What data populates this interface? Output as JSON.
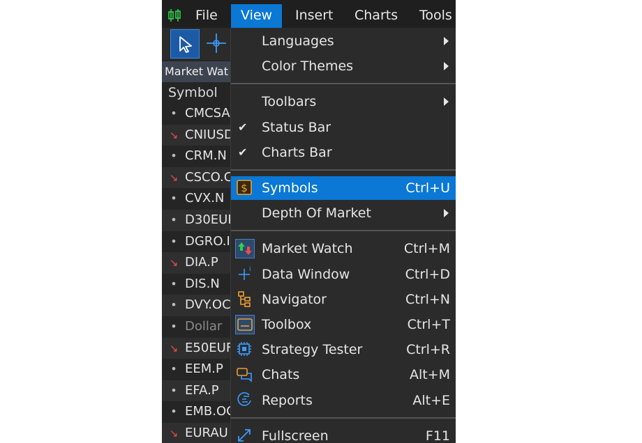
{
  "menubar": {
    "items": [
      "File",
      "View",
      "Insert",
      "Charts",
      "Tools"
    ],
    "active": "View"
  },
  "toolbar": {
    "tools": [
      "cursor-icon",
      "crosshair-icon"
    ]
  },
  "market_watch": {
    "tab_title": "Market Wat",
    "column_header": "Symbol",
    "rows": [
      {
        "symbol": "CMCSA",
        "trend": "dot",
        "dim": false
      },
      {
        "symbol": "CNIUSD",
        "trend": "down",
        "dim": false
      },
      {
        "symbol": "CRM.N",
        "trend": "dot",
        "dim": false
      },
      {
        "symbol": "CSCO.C",
        "trend": "down",
        "dim": false
      },
      {
        "symbol": "CVX.N",
        "trend": "dot",
        "dim": false
      },
      {
        "symbol": "D30EUF",
        "trend": "dot",
        "dim": false
      },
      {
        "symbol": "DGRO.I",
        "trend": "dot",
        "dim": false
      },
      {
        "symbol": "DIA.P",
        "trend": "down",
        "dim": false
      },
      {
        "symbol": "DIS.N",
        "trend": "dot",
        "dim": false
      },
      {
        "symbol": "DVY.OC",
        "trend": "dot",
        "dim": false
      },
      {
        "symbol": "Dollar",
        "trend": "dot",
        "dim": true
      },
      {
        "symbol": "E50EUF",
        "trend": "down",
        "dim": false
      },
      {
        "symbol": "EEM.P",
        "trend": "dot",
        "dim": false
      },
      {
        "symbol": "EFA.P",
        "trend": "dot",
        "dim": false
      },
      {
        "symbol": "EMB.OC",
        "trend": "dot",
        "dim": false
      },
      {
        "symbol": "EURAU",
        "trend": "down",
        "dim": false
      }
    ]
  },
  "view_menu": {
    "groups": [
      [
        {
          "label": "Languages",
          "submenu": true
        },
        {
          "label": "Color Themes",
          "submenu": true
        }
      ],
      [
        {
          "label": "Toolbars",
          "submenu": true
        },
        {
          "label": "Status Bar",
          "checked": true
        },
        {
          "label": "Charts Bar",
          "checked": true
        }
      ],
      [
        {
          "label": "Symbols",
          "shortcut": "Ctrl+U",
          "icon": "symbols-dollar-icon",
          "highlighted": true
        },
        {
          "label": "Depth Of Market",
          "submenu": true
        }
      ],
      [
        {
          "label": "Market Watch",
          "shortcut": "Ctrl+M",
          "icon": "market-watch-icon",
          "boxed": true
        },
        {
          "label": "Data Window",
          "shortcut": "Ctrl+D",
          "icon": "data-window-icon"
        },
        {
          "label": "Navigator",
          "shortcut": "Ctrl+N",
          "icon": "navigator-icon"
        },
        {
          "label": "Toolbox",
          "shortcut": "Ctrl+T",
          "icon": "toolbox-icon",
          "boxed": true
        },
        {
          "label": "Strategy Tester",
          "shortcut": "Ctrl+R",
          "icon": "strategy-tester-icon"
        },
        {
          "label": "Chats",
          "shortcut": "Alt+M",
          "icon": "chats-icon"
        },
        {
          "label": "Reports",
          "shortcut": "Alt+E",
          "icon": "reports-icon"
        }
      ],
      [
        {
          "label": "Fullscreen",
          "shortcut": "F11",
          "icon": "fullscreen-icon"
        }
      ]
    ]
  },
  "colors": {
    "accent": "#0a78d4",
    "trend_down": "#ef4b4b",
    "menu_bg": "#2b2b2b",
    "app_bg": "#252525"
  }
}
